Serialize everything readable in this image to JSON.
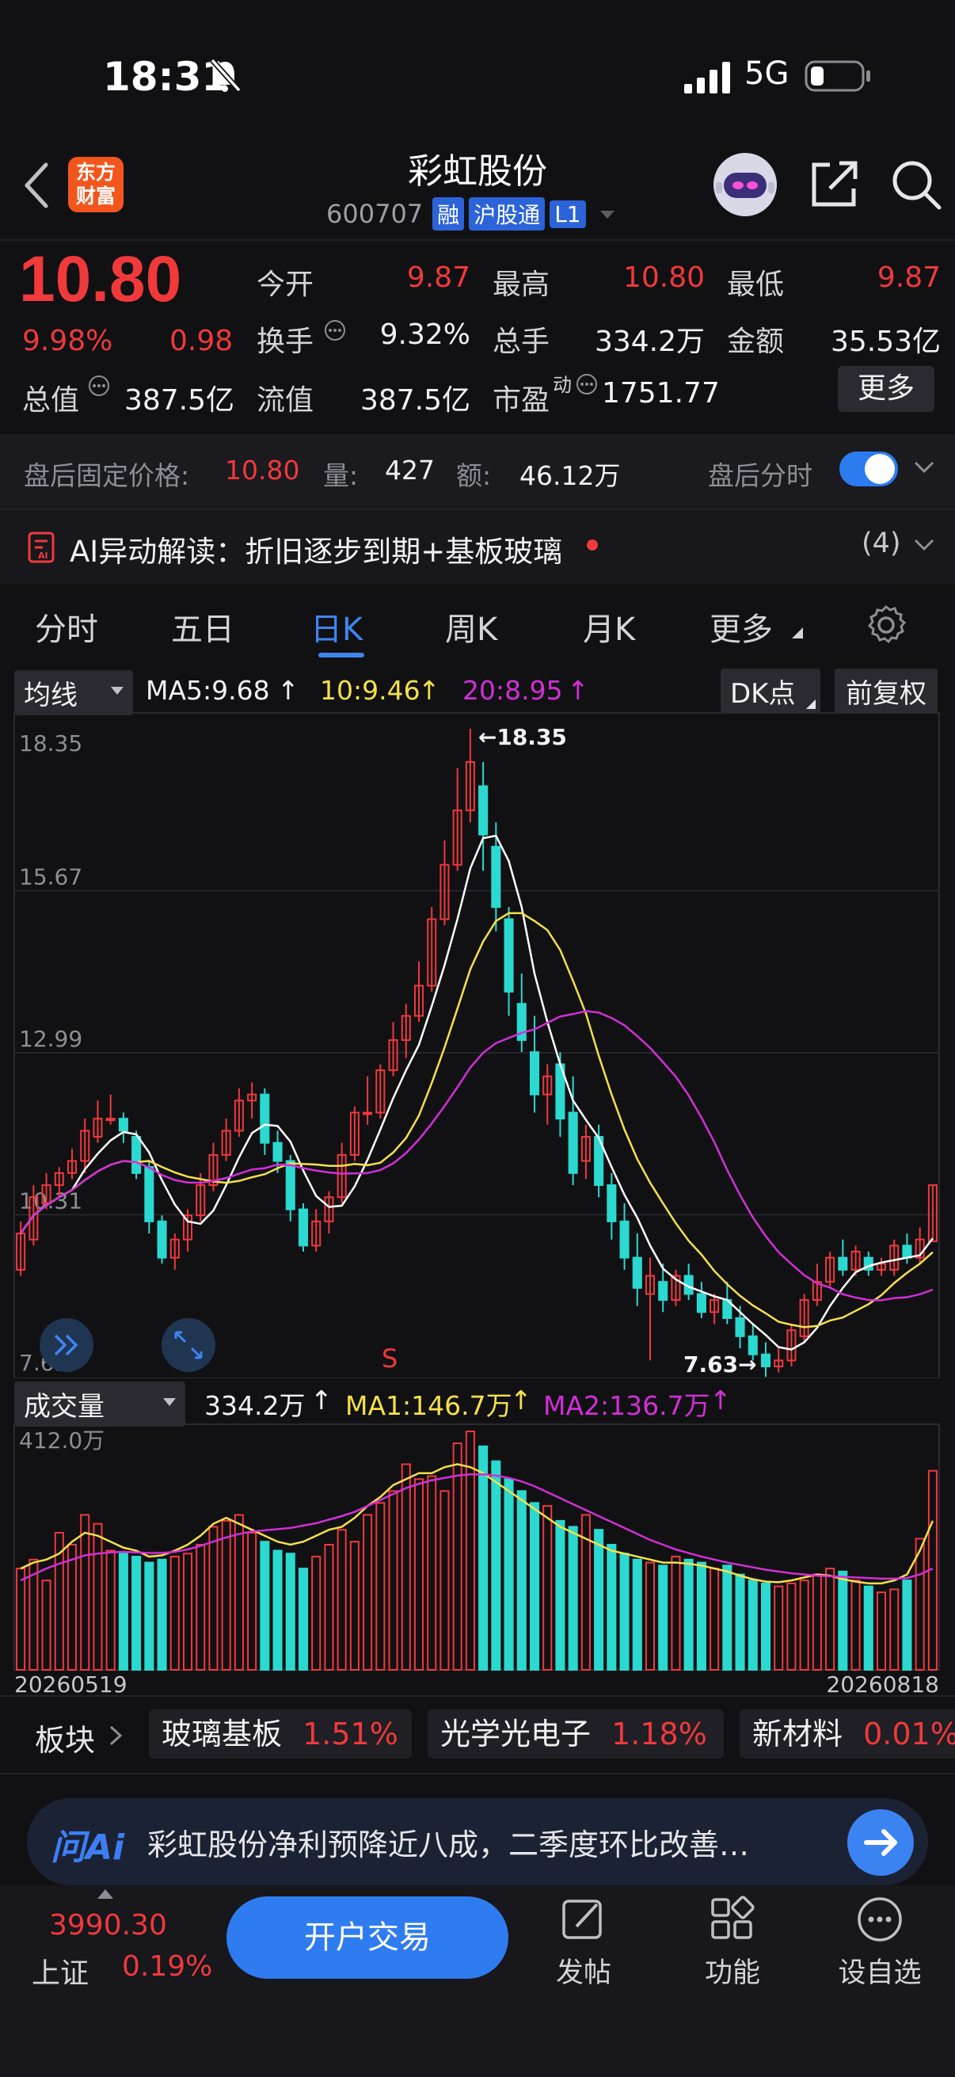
{
  "status": {
    "time": "18:31",
    "network": "5G"
  },
  "header": {
    "logo_line1": "东方",
    "logo_line2": "财富",
    "stock_name": "彩虹股份",
    "code": "600707",
    "tags": [
      "融",
      "沪股通",
      "L1"
    ]
  },
  "quote": {
    "price": "10.80",
    "change_pct": "9.98%",
    "change": "0.98",
    "fields": [
      {
        "label": "今开",
        "value": "9.87",
        "color": "red"
      },
      {
        "label": "最高",
        "value": "10.80",
        "color": "red"
      },
      {
        "label": "最低",
        "value": "9.87",
        "color": "red"
      },
      {
        "label": "换手",
        "value": "9.32%",
        "color": "white"
      },
      {
        "label": "总手",
        "value": "334.2万",
        "color": "white"
      },
      {
        "label": "金额",
        "value": "35.53亿",
        "color": "white"
      },
      {
        "label": "总值",
        "value": "387.5亿",
        "color": "white"
      },
      {
        "label": "流值",
        "value": "387.5亿",
        "color": "white"
      },
      {
        "label": "市盈",
        "value": "1751.77",
        "color": "white"
      }
    ],
    "pe_superscript": "动",
    "more_button": "更多"
  },
  "after_hours": {
    "fixed_price_label": "盘后固定价格:",
    "fixed_price": "10.80",
    "volume_label": "量:",
    "volume": "427",
    "amount_label": "额:",
    "amount": "46.12万",
    "timeshare_label": "盘后分时"
  },
  "ai_alert": {
    "text": "AI异动解读：折旧逐步到期+基板玻璃",
    "count": "(4)"
  },
  "tabs": [
    "分时",
    "五日",
    "日K",
    "周K",
    "月K",
    "更多"
  ],
  "active_tab": "日K",
  "indicators": {
    "ma_dropdown": "均线",
    "ma5": "MA5:9.68",
    "ma10": "10:9.46",
    "ma20": "20:8.95",
    "dk_button": "DK点",
    "adjust_button": "前复权",
    "vol_dropdown": "成交量",
    "vol": "334.2万",
    "vol_ma1": "MA1:146.7万",
    "vol_ma2": "MA2:136.7万"
  },
  "colors": {
    "up": "#f0393b",
    "down": "#2bd9d0",
    "ma5": "#ffffff",
    "ma10": "#f4e04b",
    "ma20": "#d22fd6",
    "accent": "#2f7cf0"
  },
  "chart_data": [
    {
      "type": "candlestick",
      "y_ticks": [
        "18.35",
        "15.67",
        "12.99",
        "10.31",
        "7.63"
      ],
      "ylim": [
        7.63,
        18.35
      ],
      "annotations": {
        "high": "←18.35",
        "low": "7.63→",
        "signal": "S"
      },
      "candles": [
        [
          9.4,
          10.0,
          10.2,
          9.3
        ],
        [
          9.9,
          10.6,
          10.8,
          9.8
        ],
        [
          10.5,
          10.8,
          11.0,
          10.4
        ],
        [
          10.8,
          11.0,
          11.1,
          10.6
        ],
        [
          11.0,
          11.2,
          11.4,
          10.9
        ],
        [
          11.2,
          11.7,
          11.9,
          11.0
        ],
        [
          11.6,
          11.9,
          12.2,
          11.5
        ],
        [
          11.9,
          11.9,
          12.3,
          11.8
        ],
        [
          11.9,
          11.7,
          12.0,
          11.5
        ],
        [
          11.6,
          11.0,
          11.7,
          10.9
        ],
        [
          11.1,
          10.2,
          11.2,
          10.0
        ],
        [
          10.2,
          9.6,
          10.3,
          9.5
        ],
        [
          9.6,
          9.9,
          10.0,
          9.4
        ],
        [
          9.9,
          10.3,
          10.4,
          9.7
        ],
        [
          10.3,
          10.8,
          11.0,
          10.2
        ],
        [
          10.8,
          11.3,
          11.5,
          10.7
        ],
        [
          11.3,
          11.7,
          11.9,
          11.2
        ],
        [
          11.7,
          12.2,
          12.4,
          11.6
        ],
        [
          12.2,
          12.3,
          12.5,
          11.9
        ],
        [
          12.3,
          11.5,
          12.4,
          11.3
        ],
        [
          11.5,
          11.2,
          11.7,
          11.0
        ],
        [
          11.2,
          10.4,
          11.3,
          10.2
        ],
        [
          10.4,
          9.8,
          10.5,
          9.7
        ],
        [
          9.8,
          10.2,
          10.4,
          9.7
        ],
        [
          10.2,
          10.6,
          10.7,
          10.0
        ],
        [
          10.6,
          11.3,
          11.5,
          10.5
        ],
        [
          11.3,
          12.0,
          12.1,
          11.2
        ],
        [
          12.0,
          12.0,
          12.6,
          11.8
        ],
        [
          12.0,
          12.7,
          12.8,
          11.9
        ],
        [
          12.7,
          13.2,
          13.5,
          12.6
        ],
        [
          13.2,
          13.6,
          13.8,
          12.9
        ],
        [
          13.6,
          14.1,
          14.5,
          13.5
        ],
        [
          14.1,
          15.2,
          15.4,
          14.0
        ],
        [
          15.2,
          16.1,
          16.5,
          15.1
        ],
        [
          16.1,
          17.0,
          17.7,
          16.0
        ],
        [
          17.0,
          17.8,
          18.35,
          16.8
        ],
        [
          17.4,
          16.6,
          17.8,
          16.0
        ],
        [
          16.4,
          15.4,
          16.8,
          15.0
        ],
        [
          15.2,
          14.0,
          15.4,
          13.6
        ],
        [
          13.8,
          13.2,
          14.3,
          13.0
        ],
        [
          13.0,
          12.3,
          13.6,
          12.0
        ],
        [
          12.3,
          12.6,
          12.8,
          11.8
        ],
        [
          12.8,
          11.9,
          13.0,
          11.6
        ],
        [
          12.0,
          11.0,
          12.6,
          10.8
        ],
        [
          11.2,
          11.6,
          11.8,
          10.9
        ],
        [
          11.6,
          10.8,
          11.8,
          10.6
        ],
        [
          10.8,
          10.2,
          11.0,
          9.9
        ],
        [
          10.2,
          9.6,
          10.5,
          9.4
        ],
        [
          9.6,
          9.1,
          10.0,
          8.8
        ],
        [
          9.0,
          9.3,
          9.6,
          7.9
        ],
        [
          9.2,
          8.9,
          9.5,
          8.7
        ],
        [
          8.9,
          9.3,
          9.4,
          8.8
        ],
        [
          9.3,
          9.0,
          9.5,
          8.9
        ],
        [
          9.0,
          8.7,
          9.2,
          8.6
        ],
        [
          8.7,
          8.9,
          9.0,
          8.5
        ],
        [
          8.9,
          8.6,
          9.2,
          8.5
        ],
        [
          8.6,
          8.3,
          8.8,
          8.1
        ],
        [
          8.3,
          8.0,
          8.5,
          7.9
        ],
        [
          8.0,
          7.8,
          8.2,
          7.63
        ],
        [
          7.8,
          7.9,
          8.1,
          7.7
        ],
        [
          7.9,
          8.4,
          8.5,
          7.8
        ],
        [
          8.3,
          8.9,
          9.0,
          8.2
        ],
        [
          8.9,
          9.2,
          9.5,
          8.8
        ],
        [
          9.2,
          9.6,
          9.7,
          9.1
        ],
        [
          9.6,
          9.4,
          9.9,
          9.3
        ],
        [
          9.4,
          9.7,
          9.8,
          9.3
        ],
        [
          9.6,
          9.4,
          9.7,
          9.3
        ],
        [
          9.4,
          9.5,
          9.6,
          9.3
        ],
        [
          9.4,
          9.8,
          9.9,
          9.3
        ],
        [
          9.8,
          9.6,
          10.0,
          9.5
        ],
        [
          9.6,
          9.9,
          10.1,
          9.5
        ],
        [
          9.87,
          10.8,
          10.8,
          9.87
        ]
      ]
    },
    {
      "type": "bar",
      "y_ticks": [
        "412.0万"
      ],
      "ylim": [
        0,
        412
      ],
      "x_ticks": [
        "20260519",
        "20260818"
      ],
      "values": [
        170,
        185,
        150,
        230,
        210,
        260,
        245,
        200,
        195,
        190,
        180,
        185,
        190,
        195,
        210,
        240,
        250,
        260,
        230,
        215,
        200,
        195,
        170,
        190,
        210,
        235,
        215,
        260,
        280,
        300,
        345,
        320,
        325,
        300,
        380,
        400,
        375,
        350,
        320,
        300,
        280,
        275,
        250,
        240,
        260,
        235,
        210,
        195,
        185,
        180,
        175,
        190,
        185,
        180,
        170,
        175,
        160,
        150,
        145,
        140,
        145,
        150,
        160,
        170,
        165,
        150,
        140,
        130,
        135,
        150,
        220,
        334
      ],
      "ma1": [
        170,
        180,
        185,
        195,
        215,
        230,
        225,
        215,
        205,
        200,
        190,
        192,
        200,
        210,
        225,
        245,
        255,
        245,
        235,
        225,
        215,
        210,
        215,
        225,
        235,
        240,
        255,
        275,
        290,
        310,
        320,
        330,
        330,
        340,
        345,
        340,
        330,
        315,
        300,
        285,
        270,
        255,
        240,
        230,
        220,
        210,
        200,
        195,
        190,
        185,
        180,
        180,
        178,
        175,
        170,
        165,
        158,
        152,
        148,
        147,
        150,
        155,
        160,
        158,
        152,
        148,
        145,
        145,
        150,
        160,
        200,
        250
      ],
      "ma2": [
        150,
        160,
        170,
        178,
        185,
        192,
        195,
        197,
        198,
        197,
        196,
        196,
        198,
        202,
        208,
        215,
        222,
        228,
        232,
        234,
        236,
        238,
        242,
        246,
        252,
        258,
        265,
        275,
        285,
        295,
        305,
        312,
        318,
        322,
        326,
        328,
        328,
        326,
        322,
        316,
        308,
        298,
        288,
        278,
        268,
        258,
        248,
        238,
        228,
        218,
        210,
        202,
        196,
        190,
        185,
        180,
        176,
        172,
        168,
        165,
        162,
        160,
        158,
        157,
        156,
        155,
        154,
        153,
        153,
        154,
        160,
        170
      ]
    }
  ],
  "sectors": {
    "label": "板块",
    "items": [
      {
        "name": "玻璃基板",
        "pct": "1.51%"
      },
      {
        "name": "光学光电子",
        "pct": "1.18%"
      },
      {
        "name": "新材料",
        "pct": "0.01%"
      }
    ]
  },
  "ai_input": {
    "logo": "问Ai",
    "question": "彩虹股份净利预降近八成，二季度环比改善…"
  },
  "bottom": {
    "index_value": "3990.30",
    "index_name": "上证",
    "index_pct": "0.19%",
    "trade_button": "开户交易",
    "nav": [
      {
        "label": "发帖",
        "icon": "edit-icon"
      },
      {
        "label": "功能",
        "icon": "grid-icon"
      },
      {
        "label": "设自选",
        "icon": "more-icon"
      }
    ]
  }
}
